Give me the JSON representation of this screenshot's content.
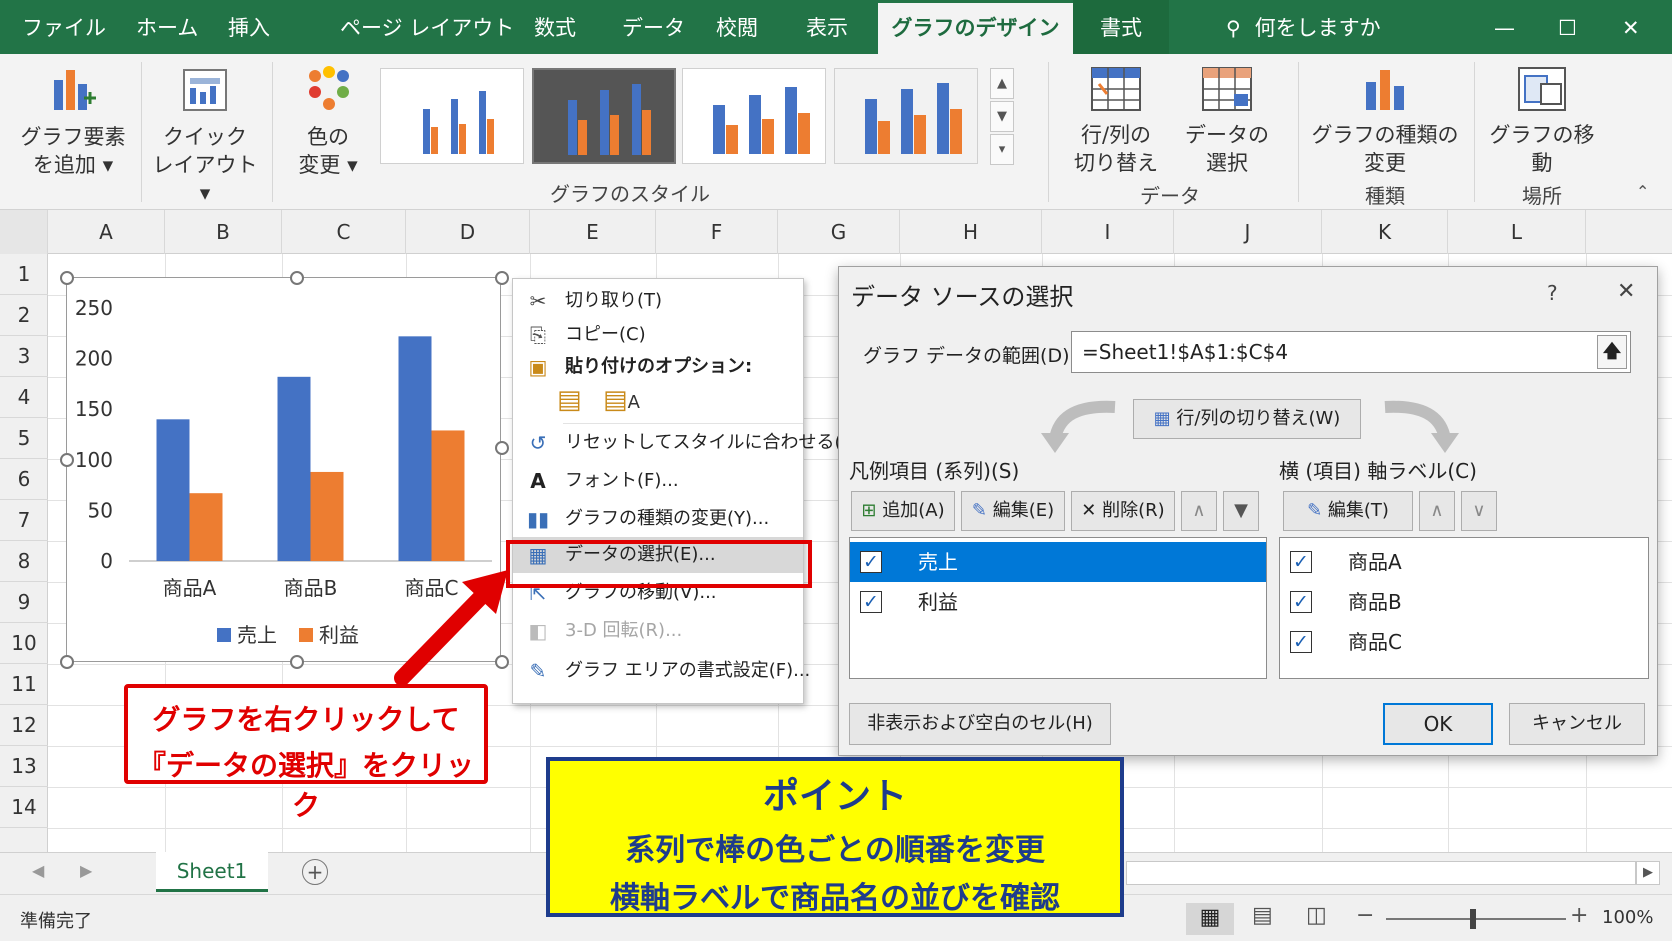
{
  "tabs": [
    "ファイル",
    "ホーム",
    "挿入",
    "ページ レイアウト",
    "数式",
    "データ",
    "校閲",
    "表示",
    "グラフのデザイン",
    "書式"
  ],
  "tell_me": "何をしますか",
  "window_controls": {
    "minimize": "—",
    "maximize": "☐",
    "close": "✕"
  },
  "ribbon": {
    "add_element": "グラフ要素\nを追加 ▾",
    "quick_layout": "クイック\nレイアウト ▾",
    "change_colors": "色の\n変更 ▾",
    "styles_group": "グラフのスタイル",
    "switch_rowcol": "行/列の\n切り替え",
    "select_data": "データの\n選択",
    "data_group": "データ",
    "change_type": "グラフの種類の\n変更",
    "type_group": "種類",
    "move_chart": "グラフの移動",
    "location_group": "場所"
  },
  "columns": [
    "A",
    "B",
    "C",
    "D",
    "E",
    "F",
    "G",
    "H",
    "I",
    "J",
    "K",
    "L"
  ],
  "rows": [
    "1",
    "2",
    "3",
    "4",
    "5",
    "6",
    "7",
    "8",
    "9",
    "10",
    "11",
    "12",
    "13",
    "14"
  ],
  "chart_data": {
    "type": "bar",
    "categories": [
      "商品A",
      "商品B",
      "商品C"
    ],
    "series": [
      {
        "name": "売上",
        "values": [
          140,
          182,
          222
        ],
        "color": "#4472c4"
      },
      {
        "name": "利益",
        "values": [
          67,
          88,
          129
        ],
        "color": "#ed7d31"
      }
    ],
    "ylim": [
      0,
      250
    ],
    "yticks": [
      "0",
      "50",
      "100",
      "150",
      "200",
      "250"
    ],
    "legend": "bottom",
    "grid": false
  },
  "context_menu": {
    "items": [
      {
        "label": "切り取り(T)",
        "icon": "✂"
      },
      {
        "label": "コピー(C)",
        "icon": "⎘"
      },
      {
        "label": "貼り付けのオプション:",
        "icon": "📋"
      },
      {
        "label": "リセットしてスタイルに合わせる(A)",
        "icon": "↺"
      },
      {
        "label": "フォント(F)...",
        "icon": "A"
      },
      {
        "label": "グラフの種類の変更(Y)...",
        "icon": "▮"
      },
      {
        "label": "データの選択(E)...",
        "icon": "▦"
      },
      {
        "label": "グラフの移動(V)...",
        "icon": "⇱"
      },
      {
        "label": "3-D 回転(R)...",
        "icon": "◧"
      },
      {
        "label": "グラフ エリアの書式設定(F)...",
        "icon": "✎"
      }
    ]
  },
  "dialog": {
    "title": "データ ソースの選択",
    "help": "?",
    "close": "✕",
    "range_label": "グラフ データの範囲(D):",
    "range_value": "=Sheet1!$A$1:$C$4",
    "switch_button": "行/列の切り替え(W)",
    "legend_title": "凡例項目 (系列)(S)",
    "axis_title": "横 (項目) 軸ラベル(C)",
    "add": "追加(A)",
    "edit": "編集(E)",
    "delete": "削除(R)",
    "edit_axis": "編集(T)",
    "series": [
      "売上",
      "利益"
    ],
    "categories": [
      "商品A",
      "商品B",
      "商品C"
    ],
    "hidden_cells": "非表示および空白のセル(H)",
    "ok": "OK",
    "cancel": "キャンセル"
  },
  "sheet_tab": "Sheet1",
  "status": {
    "ready": "準備完了",
    "zoom": "100%"
  },
  "annotation_red": {
    "line1": "グラフを右クリックして",
    "line2": "『データの選択』をクリック"
  },
  "point": {
    "title": "ポイント",
    "line1": "系列で棒の色ごとの順番を変更",
    "line2": "横軸ラベルで商品名の並びを確認"
  },
  "colors": {
    "excel_green": "#227447",
    "highlight": "#e00000",
    "selected": "#0078d7",
    "point_bg": "#ffff00",
    "point_border": "#1e3c8c"
  }
}
